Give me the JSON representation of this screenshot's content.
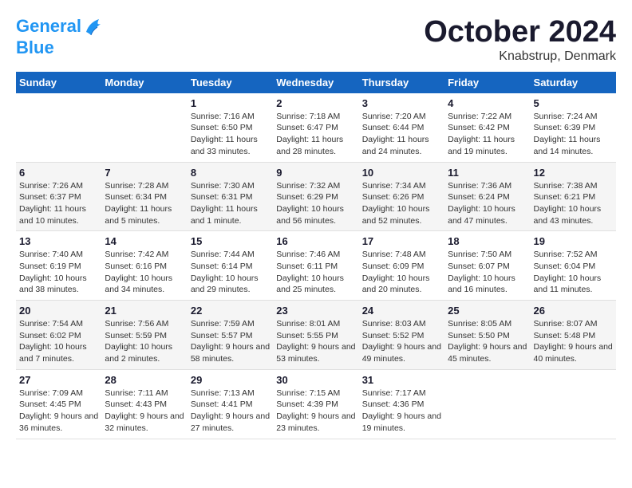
{
  "logo": {
    "line1": "General",
    "line2": "Blue"
  },
  "title": "October 2024",
  "subtitle": "Knabstrup, Denmark",
  "header_days": [
    "Sunday",
    "Monday",
    "Tuesday",
    "Wednesday",
    "Thursday",
    "Friday",
    "Saturday"
  ],
  "weeks": [
    [
      {
        "day": "",
        "sunrise": "",
        "sunset": "",
        "daylight": ""
      },
      {
        "day": "",
        "sunrise": "",
        "sunset": "",
        "daylight": ""
      },
      {
        "day": "1",
        "sunrise": "Sunrise: 7:16 AM",
        "sunset": "Sunset: 6:50 PM",
        "daylight": "Daylight: 11 hours and 33 minutes."
      },
      {
        "day": "2",
        "sunrise": "Sunrise: 7:18 AM",
        "sunset": "Sunset: 6:47 PM",
        "daylight": "Daylight: 11 hours and 28 minutes."
      },
      {
        "day": "3",
        "sunrise": "Sunrise: 7:20 AM",
        "sunset": "Sunset: 6:44 PM",
        "daylight": "Daylight: 11 hours and 24 minutes."
      },
      {
        "day": "4",
        "sunrise": "Sunrise: 7:22 AM",
        "sunset": "Sunset: 6:42 PM",
        "daylight": "Daylight: 11 hours and 19 minutes."
      },
      {
        "day": "5",
        "sunrise": "Sunrise: 7:24 AM",
        "sunset": "Sunset: 6:39 PM",
        "daylight": "Daylight: 11 hours and 14 minutes."
      }
    ],
    [
      {
        "day": "6",
        "sunrise": "Sunrise: 7:26 AM",
        "sunset": "Sunset: 6:37 PM",
        "daylight": "Daylight: 11 hours and 10 minutes."
      },
      {
        "day": "7",
        "sunrise": "Sunrise: 7:28 AM",
        "sunset": "Sunset: 6:34 PM",
        "daylight": "Daylight: 11 hours and 5 minutes."
      },
      {
        "day": "8",
        "sunrise": "Sunrise: 7:30 AM",
        "sunset": "Sunset: 6:31 PM",
        "daylight": "Daylight: 11 hours and 1 minute."
      },
      {
        "day": "9",
        "sunrise": "Sunrise: 7:32 AM",
        "sunset": "Sunset: 6:29 PM",
        "daylight": "Daylight: 10 hours and 56 minutes."
      },
      {
        "day": "10",
        "sunrise": "Sunrise: 7:34 AM",
        "sunset": "Sunset: 6:26 PM",
        "daylight": "Daylight: 10 hours and 52 minutes."
      },
      {
        "day": "11",
        "sunrise": "Sunrise: 7:36 AM",
        "sunset": "Sunset: 6:24 PM",
        "daylight": "Daylight: 10 hours and 47 minutes."
      },
      {
        "day": "12",
        "sunrise": "Sunrise: 7:38 AM",
        "sunset": "Sunset: 6:21 PM",
        "daylight": "Daylight: 10 hours and 43 minutes."
      }
    ],
    [
      {
        "day": "13",
        "sunrise": "Sunrise: 7:40 AM",
        "sunset": "Sunset: 6:19 PM",
        "daylight": "Daylight: 10 hours and 38 minutes."
      },
      {
        "day": "14",
        "sunrise": "Sunrise: 7:42 AM",
        "sunset": "Sunset: 6:16 PM",
        "daylight": "Daylight: 10 hours and 34 minutes."
      },
      {
        "day": "15",
        "sunrise": "Sunrise: 7:44 AM",
        "sunset": "Sunset: 6:14 PM",
        "daylight": "Daylight: 10 hours and 29 minutes."
      },
      {
        "day": "16",
        "sunrise": "Sunrise: 7:46 AM",
        "sunset": "Sunset: 6:11 PM",
        "daylight": "Daylight: 10 hours and 25 minutes."
      },
      {
        "day": "17",
        "sunrise": "Sunrise: 7:48 AM",
        "sunset": "Sunset: 6:09 PM",
        "daylight": "Daylight: 10 hours and 20 minutes."
      },
      {
        "day": "18",
        "sunrise": "Sunrise: 7:50 AM",
        "sunset": "Sunset: 6:07 PM",
        "daylight": "Daylight: 10 hours and 16 minutes."
      },
      {
        "day": "19",
        "sunrise": "Sunrise: 7:52 AM",
        "sunset": "Sunset: 6:04 PM",
        "daylight": "Daylight: 10 hours and 11 minutes."
      }
    ],
    [
      {
        "day": "20",
        "sunrise": "Sunrise: 7:54 AM",
        "sunset": "Sunset: 6:02 PM",
        "daylight": "Daylight: 10 hours and 7 minutes."
      },
      {
        "day": "21",
        "sunrise": "Sunrise: 7:56 AM",
        "sunset": "Sunset: 5:59 PM",
        "daylight": "Daylight: 10 hours and 2 minutes."
      },
      {
        "day": "22",
        "sunrise": "Sunrise: 7:59 AM",
        "sunset": "Sunset: 5:57 PM",
        "daylight": "Daylight: 9 hours and 58 minutes."
      },
      {
        "day": "23",
        "sunrise": "Sunrise: 8:01 AM",
        "sunset": "Sunset: 5:55 PM",
        "daylight": "Daylight: 9 hours and 53 minutes."
      },
      {
        "day": "24",
        "sunrise": "Sunrise: 8:03 AM",
        "sunset": "Sunset: 5:52 PM",
        "daylight": "Daylight: 9 hours and 49 minutes."
      },
      {
        "day": "25",
        "sunrise": "Sunrise: 8:05 AM",
        "sunset": "Sunset: 5:50 PM",
        "daylight": "Daylight: 9 hours and 45 minutes."
      },
      {
        "day": "26",
        "sunrise": "Sunrise: 8:07 AM",
        "sunset": "Sunset: 5:48 PM",
        "daylight": "Daylight: 9 hours and 40 minutes."
      }
    ],
    [
      {
        "day": "27",
        "sunrise": "Sunrise: 7:09 AM",
        "sunset": "Sunset: 4:45 PM",
        "daylight": "Daylight: 9 hours and 36 minutes."
      },
      {
        "day": "28",
        "sunrise": "Sunrise: 7:11 AM",
        "sunset": "Sunset: 4:43 PM",
        "daylight": "Daylight: 9 hours and 32 minutes."
      },
      {
        "day": "29",
        "sunrise": "Sunrise: 7:13 AM",
        "sunset": "Sunset: 4:41 PM",
        "daylight": "Daylight: 9 hours and 27 minutes."
      },
      {
        "day": "30",
        "sunrise": "Sunrise: 7:15 AM",
        "sunset": "Sunset: 4:39 PM",
        "daylight": "Daylight: 9 hours and 23 minutes."
      },
      {
        "day": "31",
        "sunrise": "Sunrise: 7:17 AM",
        "sunset": "Sunset: 4:36 PM",
        "daylight": "Daylight: 9 hours and 19 minutes."
      },
      {
        "day": "",
        "sunrise": "",
        "sunset": "",
        "daylight": ""
      },
      {
        "day": "",
        "sunrise": "",
        "sunset": "",
        "daylight": ""
      }
    ]
  ]
}
